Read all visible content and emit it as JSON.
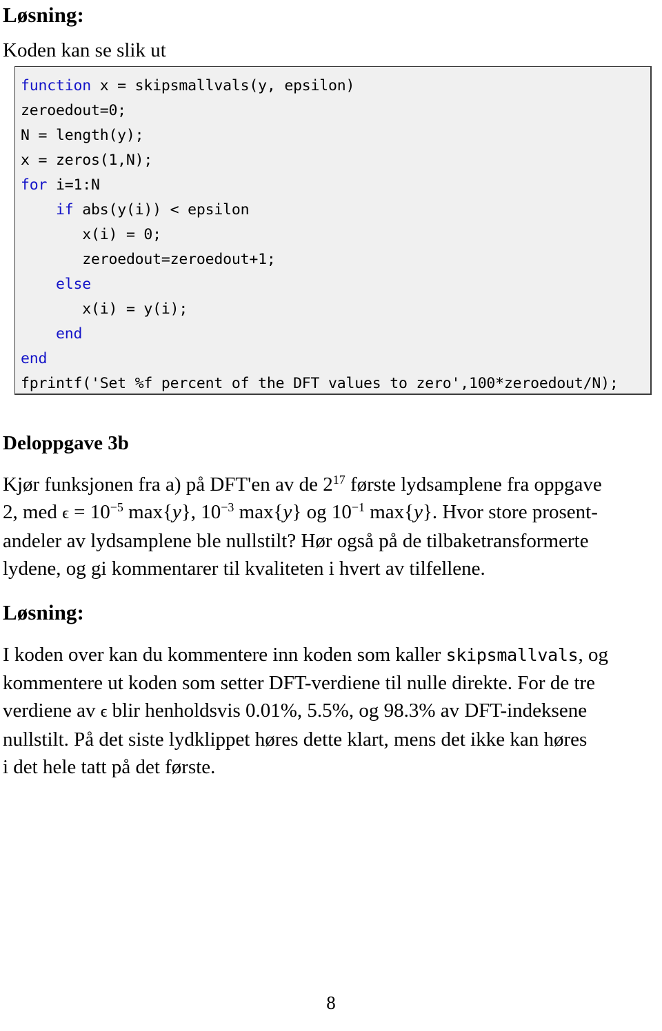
{
  "document": {
    "page_number": "8",
    "solution_heading": "Løsning:",
    "lead_line": "Koden kan se slik ut",
    "section_heading": "Deloppgave 3b",
    "solution_heading_2": "Løsning:"
  },
  "code_block": {
    "language": "matlab",
    "keyword_color": "#1414c8",
    "background_color": "#f0f0f0",
    "border_color": "#3a3a3a",
    "lines": [
      {
        "keyword": "function",
        "rest": " x = skipsmallvals(y, epsilon)",
        "indent": ""
      },
      {
        "keyword": "",
        "rest": "zeroedout=0;",
        "indent": ""
      },
      {
        "keyword": "",
        "rest": "N = length(y);",
        "indent": ""
      },
      {
        "keyword": "",
        "rest": "x = zeros(1,N);",
        "indent": ""
      },
      {
        "keyword": "for",
        "rest": " i=1:N",
        "indent": ""
      },
      {
        "keyword": "if",
        "rest": " abs(y(i)) < epsilon",
        "indent": "    "
      },
      {
        "keyword": "",
        "rest": "x(i) = 0;",
        "indent": "       "
      },
      {
        "keyword": "",
        "rest": "zeroedout=zeroedout+1;",
        "indent": "       "
      },
      {
        "keyword": "else",
        "rest": "",
        "indent": "    "
      },
      {
        "keyword": "",
        "rest": "x(i) = y(i);",
        "indent": "       "
      },
      {
        "keyword": "end",
        "rest": "",
        "indent": "    "
      },
      {
        "keyword": "end",
        "rest": "",
        "indent": ""
      },
      {
        "keyword": "",
        "rest": "fprintf('Set %f percent of the DFT values to zero',100*zeroedout/N);",
        "indent": ""
      }
    ]
  },
  "task_paragraph": {
    "line1_a": "Kjør funksjonen fra a) på DFT'en av de 2",
    "line1_sup": "17",
    "line1_b": " første lydsamplene fra oppgave",
    "line2_a": "2, med ",
    "line2_eps": "ϵ",
    "line2_b": " = 10",
    "line2_sup1": "−5",
    "line2_c": " max{",
    "line2_y1": "y",
    "line2_d": "}, 10",
    "line2_sup2": "−3",
    "line2_e": " max{",
    "line2_y2": "y",
    "line2_f": "} og 10",
    "line2_sup3": "−1",
    "line2_g": " max{",
    "line2_y3": "y",
    "line2_h": "}. Hvor store prosent-",
    "line3": "andeler av lydsamplene ble nullstilt? Hør også på de tilbaketransformerte",
    "line4": "lydene, og gi kommentarer til kvaliteten i hvert av tilfellene."
  },
  "answer_paragraph": {
    "line1_a": "I koden over kan du kommentere inn koden som kaller ",
    "line1_mono": "skipsmallvals",
    "line1_b": ", og",
    "line2": "kommentere ut koden som setter DFT-verdiene til nulle direkte. For de tre",
    "line3_a": "verdiene av ",
    "line3_eps": "ϵ",
    "line3_b": " blir henholdsvis 0.01%, 5.5%, og 98.3% av DFT-indeksene",
    "line4": "nullstilt. På det siste lydklippet høres dette klart, mens det ikke kan høres",
    "line5": "i det hele tatt på det første."
  }
}
